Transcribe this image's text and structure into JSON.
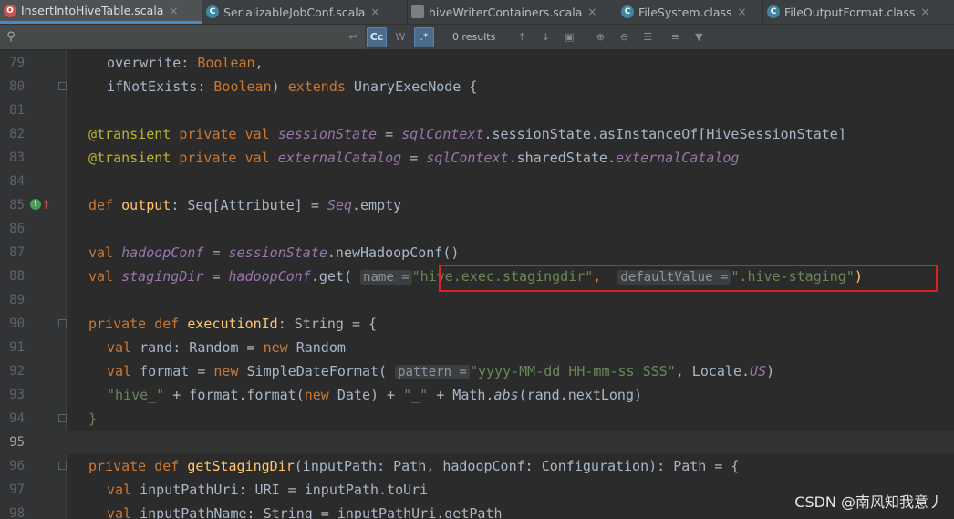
{
  "tabs": [
    {
      "label": "InsertIntoHiveTable.scala",
      "icon": "scala-object-icon",
      "active": true
    },
    {
      "label": "SerializableJobConf.scala",
      "icon": "scala-class-icon",
      "active": false
    },
    {
      "label": "hiveWriterContainers.scala",
      "icon": "scala-file-icon",
      "active": false
    },
    {
      "label": "FileSystem.class",
      "icon": "java-class-icon",
      "active": false
    },
    {
      "label": "FileOutputFormat.class",
      "icon": "java-class-icon",
      "active": false
    }
  ],
  "tab_close_glyph": "×",
  "search": {
    "placeholder": "",
    "value": "",
    "results_text": "0 results",
    "match_case_label": "Cc",
    "words_label": "W",
    "regex_label": ".*"
  },
  "editor": {
    "lines": [
      {
        "n": "79"
      },
      {
        "n": "80"
      },
      {
        "n": "81"
      },
      {
        "n": "82"
      },
      {
        "n": "83"
      },
      {
        "n": "84"
      },
      {
        "n": "85"
      },
      {
        "n": "86"
      },
      {
        "n": "87"
      },
      {
        "n": "88"
      },
      {
        "n": "89"
      },
      {
        "n": "90"
      },
      {
        "n": "91"
      },
      {
        "n": "92"
      },
      {
        "n": "93"
      },
      {
        "n": "94"
      },
      {
        "n": "95"
      },
      {
        "n": "96"
      },
      {
        "n": "97"
      },
      {
        "n": "98"
      }
    ],
    "code": {
      "l79": {
        "a": "overwrite: ",
        "b": "Boolean",
        "c": ","
      },
      "l80": {
        "a": "ifNotExists: ",
        "b": "Boolean",
        "c": ") ",
        "d": "extends",
        "e": " UnaryExecNode {"
      },
      "l82": {
        "a": "@transient",
        "b": " private ",
        "c": "val ",
        "d": "sessionState",
        "e": " = ",
        "f": "sqlContext",
        "g": ".sessionState.asInstanceOf[HiveSessionState]"
      },
      "l83": {
        "a": "@transient",
        "b": " private ",
        "c": "val ",
        "d": "externalCatalog",
        "e": " = ",
        "f": "sqlContext",
        "g": ".sharedState.",
        "h": "externalCatalog"
      },
      "l85": {
        "a": "def ",
        "b": "output",
        "c": ": ",
        "d": "Seq",
        "e": "[Attribute] = ",
        "f": "Seq",
        "g": ".empty"
      },
      "l87": {
        "a": "val ",
        "b": "hadoopConf",
        "c": " = ",
        "d": "sessionState",
        "e": ".newHadoopConf()"
      },
      "l88": {
        "a": "val ",
        "b": "stagingDir",
        "c": " = ",
        "d": "hadoopConf",
        "e": ".get(",
        "hint1": "name =",
        "f": "\"hive.exec.stagingdir\"",
        "g": ", ",
        "hint2": "defaultValue =",
        "h": "\".hive-staging\"",
        "i": ")"
      },
      "l90": {
        "a": "private ",
        "b": "def ",
        "c": "executionId",
        "d": ": ",
        "e": "String",
        "f": " = {"
      },
      "l91": {
        "a": "val ",
        "b": "rand: Random = ",
        "c": "new",
        "d": " Random"
      },
      "l92": {
        "a": "val ",
        "b": "format = ",
        "c": "new",
        "d": " SimpleDateFormat(",
        "hint": "pattern =",
        "e": "\"yyyy-MM-dd_HH-mm-ss_SSS\"",
        "f": ", Locale.",
        "g": "US",
        "h": ")"
      },
      "l93": {
        "a": "\"hive_\"",
        "b": " + format.format(",
        "c": "new",
        "d": " Date) + ",
        "e": "\"_\"",
        "f": " + Math.",
        "g": "abs",
        "h": "(rand.nextLong)"
      },
      "l94": {
        "a": "}"
      },
      "l96": {
        "a": "private ",
        "b": "def ",
        "c": "getStagingDir",
        "d": "(inputPath: Path, hadoopConf: Configuration): Path = {"
      },
      "l97": {
        "a": "val ",
        "b": "inputPathUri: URI = inputPath.toUri"
      },
      "l98": {
        "a": "val ",
        "b": "inputPathName: ",
        "c": "String",
        "d": " = inputPathUri.getPath"
      }
    }
  },
  "gutter_mark_glyph": "!",
  "gutter_arrow_glyph": "↑",
  "watermark": "CSDN @南风知我意丿",
  "colors": {
    "keyword": "#cc7832",
    "annotation": "#bbb529",
    "field": "#9876aa",
    "method": "#ffc66d",
    "string": "#6a8759",
    "highlight_box": "#e02020"
  }
}
